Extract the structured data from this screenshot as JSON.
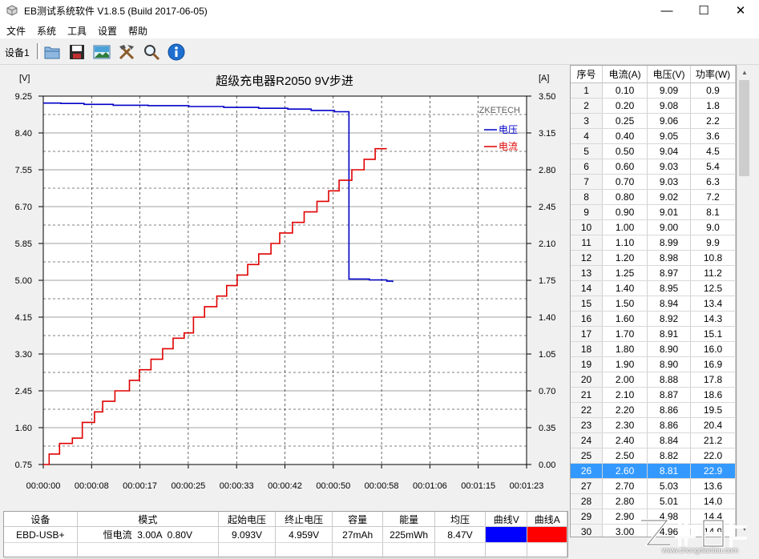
{
  "window": {
    "title": "EB测试系统软件 V1.8.5 (Build 2017-06-05)",
    "minimize_glyph": "—",
    "maximize_glyph": "☐",
    "close_glyph": "✕"
  },
  "menu": [
    "文件",
    "系统",
    "工具",
    "设置",
    "帮助"
  ],
  "toolbar": {
    "tab_label": "设备1",
    "buttons": [
      "open-folder-icon",
      "save-disk-icon",
      "image-picture-icon",
      "tools-icon",
      "search-magnifier-icon",
      "info-icon"
    ]
  },
  "chart_data": {
    "type": "line",
    "title": "超级充电器R2050 9V步进",
    "watermark": "ZKETECH",
    "ylabel_left": "[V]",
    "ylabel_right": "[A]",
    "x_ticks": [
      "00:00:00",
      "00:00:08",
      "00:00:17",
      "00:00:25",
      "00:00:33",
      "00:00:42",
      "00:00:50",
      "00:00:58",
      "00:01:06",
      "00:01:15",
      "00:01:23"
    ],
    "y_left_ticks": [
      "9.25",
      "8.40",
      "7.55",
      "6.70",
      "5.85",
      "5.00",
      "4.15",
      "3.30",
      "2.45",
      "1.60",
      "0.75"
    ],
    "y_right_ticks": [
      "3.50",
      "3.15",
      "2.80",
      "2.45",
      "2.10",
      "1.75",
      "1.40",
      "1.05",
      "0.70",
      "0.35",
      "0.00"
    ],
    "xlim_seconds": [
      0,
      83
    ],
    "ylim_left": [
      0.75,
      9.25
    ],
    "ylim_right": [
      0.0,
      3.5
    ],
    "legend_position": "top-right",
    "grid": true,
    "series": [
      {
        "name": "电压",
        "axis": "left",
        "color": "#0000c8",
        "points": [
          [
            0,
            9.09
          ],
          [
            3,
            9.08
          ],
          [
            7,
            9.06
          ],
          [
            12,
            9.04
          ],
          [
            18,
            9.03
          ],
          [
            25,
            9.01
          ],
          [
            31,
            8.99
          ],
          [
            37,
            8.97
          ],
          [
            42,
            8.95
          ],
          [
            46,
            8.92
          ],
          [
            50,
            8.89
          ],
          [
            52.5,
            8.86
          ],
          [
            52.5,
            5.03
          ],
          [
            56,
            5.01
          ],
          [
            59,
            4.98
          ],
          [
            60,
            4.96
          ]
        ]
      },
      {
        "name": "电流",
        "axis": "right",
        "color": "#e00000",
        "points": [
          [
            0,
            0.0
          ],
          [
            1,
            0.1
          ],
          [
            2.8,
            0.2
          ],
          [
            5,
            0.25
          ],
          [
            6.7,
            0.4
          ],
          [
            8.8,
            0.5
          ],
          [
            10.2,
            0.6
          ],
          [
            12.3,
            0.7
          ],
          [
            14.8,
            0.8
          ],
          [
            16.5,
            0.9
          ],
          [
            18.5,
            1.0
          ],
          [
            20.5,
            1.1
          ],
          [
            22.3,
            1.2
          ],
          [
            24.2,
            1.25
          ],
          [
            25.8,
            1.4
          ],
          [
            27.7,
            1.5
          ],
          [
            29.8,
            1.6
          ],
          [
            31.5,
            1.7
          ],
          [
            33.3,
            1.8
          ],
          [
            35.1,
            1.9
          ],
          [
            37.0,
            2.0
          ],
          [
            39.1,
            2.1
          ],
          [
            40.6,
            2.2
          ],
          [
            42.8,
            2.3
          ],
          [
            44.8,
            2.4
          ],
          [
            47.0,
            2.5
          ],
          [
            49.0,
            2.6
          ],
          [
            50.8,
            2.7
          ],
          [
            53.0,
            2.8
          ],
          [
            55.1,
            2.9
          ],
          [
            57.0,
            3.0
          ],
          [
            59.0,
            3.0
          ]
        ]
      }
    ]
  },
  "side_table": {
    "headers": [
      "序号",
      "电流(A)",
      "电压(V)",
      "功率(W)"
    ],
    "selected_row": 25,
    "rows": [
      [
        "1",
        "0.10",
        "9.09",
        "0.9"
      ],
      [
        "2",
        "0.20",
        "9.08",
        "1.8"
      ],
      [
        "3",
        "0.25",
        "9.06",
        "2.2"
      ],
      [
        "4",
        "0.40",
        "9.05",
        "3.6"
      ],
      [
        "5",
        "0.50",
        "9.04",
        "4.5"
      ],
      [
        "6",
        "0.60",
        "9.03",
        "5.4"
      ],
      [
        "7",
        "0.70",
        "9.03",
        "6.3"
      ],
      [
        "8",
        "0.80",
        "9.02",
        "7.2"
      ],
      [
        "9",
        "0.90",
        "9.01",
        "8.1"
      ],
      [
        "10",
        "1.00",
        "9.00",
        "9.0"
      ],
      [
        "11",
        "1.10",
        "8.99",
        "9.9"
      ],
      [
        "12",
        "1.20",
        "8.98",
        "10.8"
      ],
      [
        "13",
        "1.25",
        "8.97",
        "11.2"
      ],
      [
        "14",
        "1.40",
        "8.95",
        "12.5"
      ],
      [
        "15",
        "1.50",
        "8.94",
        "13.4"
      ],
      [
        "16",
        "1.60",
        "8.92",
        "14.3"
      ],
      [
        "17",
        "1.70",
        "8.91",
        "15.1"
      ],
      [
        "18",
        "1.80",
        "8.90",
        "16.0"
      ],
      [
        "19",
        "1.90",
        "8.90",
        "16.9"
      ],
      [
        "20",
        "2.00",
        "8.88",
        "17.8"
      ],
      [
        "21",
        "2.10",
        "8.87",
        "18.6"
      ],
      [
        "22",
        "2.20",
        "8.86",
        "19.5"
      ],
      [
        "23",
        "2.30",
        "8.86",
        "20.4"
      ],
      [
        "24",
        "2.40",
        "8.84",
        "21.2"
      ],
      [
        "25",
        "2.50",
        "8.82",
        "22.0"
      ],
      [
        "26",
        "2.60",
        "8.81",
        "22.9"
      ],
      [
        "27",
        "2.70",
        "5.03",
        "13.6"
      ],
      [
        "28",
        "2.80",
        "5.01",
        "14.0"
      ],
      [
        "29",
        "2.90",
        "4.98",
        "14.4"
      ],
      [
        "30",
        "3.00",
        "4.96",
        "14.9"
      ]
    ]
  },
  "bottom_table": {
    "headers": [
      "设备",
      "模式",
      "起始电压",
      "终止电压",
      "容量",
      "能量",
      "均压",
      "曲线V",
      "曲线A"
    ],
    "row": [
      "EBD-USB+",
      "恒电流  3.00A  0.80V",
      "9.093V",
      "4.959V",
      "27mAh",
      "225mWh",
      "8.47V",
      "",
      ""
    ],
    "curve_v_color": "#0000ff",
    "curve_a_color": "#ff0000"
  },
  "watermark": {
    "logo_text": "充电头",
    "url": "www.chongdiantou.com"
  }
}
